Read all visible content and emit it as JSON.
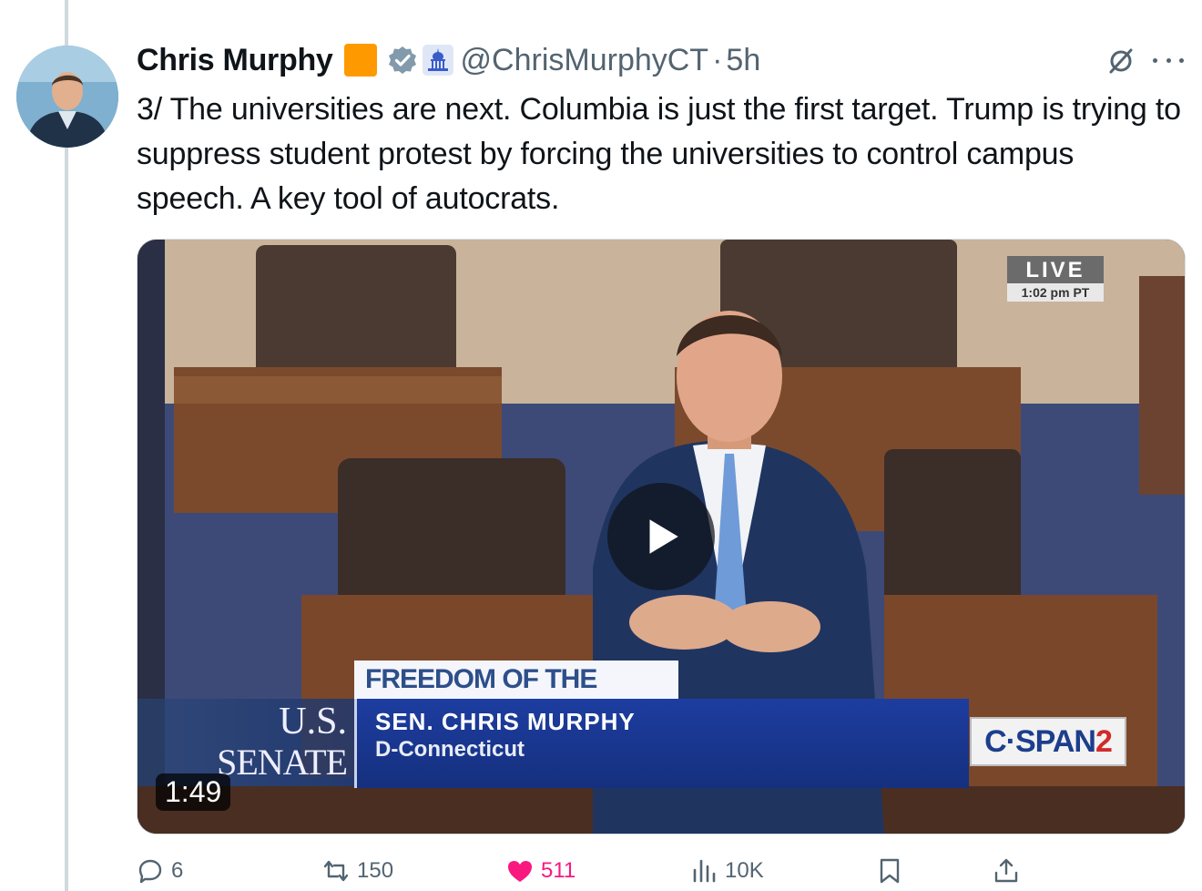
{
  "author": {
    "name": "Chris Murphy",
    "handle": "@ChrisMurphyCT",
    "separator": "·",
    "time": "5h",
    "emoji_color": "#ff9900",
    "verified_color": "#829aab"
  },
  "tweet": {
    "text": "3/ The universities are next. Columbia is just the first target. Trump is trying to suppress student protest by forcing the universities to control campus speech. A key tool of autocrats."
  },
  "video": {
    "live_label": "LIVE",
    "live_time": "1:02 pm PT",
    "topic": "FREEDOM OF THE PRESS",
    "senate_us": "U.S.",
    "senate_word": "SENATE",
    "speaker_name": "SEN. CHRIS MURPHY",
    "speaker_state": "D-Connecticut",
    "network_prefix": "C·SPAN",
    "network_num": "2",
    "duration": "1:49"
  },
  "actions": {
    "replies": "6",
    "reposts": "150",
    "likes": "511",
    "views": "10K"
  },
  "colors": {
    "text": "#0f1419",
    "muted": "#536471",
    "like": "#f91880",
    "thread_line": "#cfd9de"
  },
  "icons": [
    "verified-icon",
    "government-affiliation-icon",
    "grok-icon",
    "more-icon",
    "play-icon",
    "reply-icon",
    "repost-icon",
    "like-icon",
    "views-icon",
    "bookmark-icon",
    "share-icon"
  ]
}
